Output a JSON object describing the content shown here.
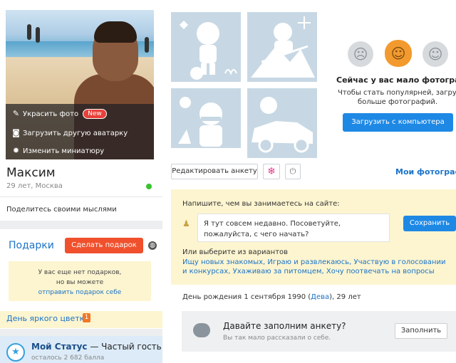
{
  "profile": {
    "name": "Максим",
    "meta": "29 лет, Москва",
    "share_prompt": "Поделитесь своими мыслями",
    "avatar_menu": {
      "decorate": "Украсить фото",
      "decorate_badge": "New",
      "upload_other": "Загрузить другую аватарку",
      "change_thumb": "Изменить миниатюру"
    }
  },
  "gifts": {
    "title": "Подарки",
    "make_gift": "Сделать подарок",
    "empty_text": "У вас еще нет подарков, но вы можете",
    "send_self": "отправить подарок себе",
    "flower_day": "День яркого цветка",
    "flower_count": "1"
  },
  "status": {
    "title": "Мой Статус",
    "level": "Частый гость",
    "sub": "осталось 2 682 балла"
  },
  "photos": {
    "edit_button": "Редактировать анкету",
    "title": "Сейчас у вас мало фотографий",
    "subtitle_1": "Чтобы стать популярней, загрузите",
    "subtitle_2": "больше фотографий.",
    "upload_button": "Загрузить с компьютера",
    "my_photos": "Мои фотографии",
    "faces": [
      "sad",
      "neutral-selected",
      "smile"
    ]
  },
  "about": {
    "label": "Напишите, чем вы занимаетесь на сайте:",
    "input_value": "Я тут совсем недавно. Посоветуйте, пожалуйста, с чего начать?",
    "save_button": "Сохранить",
    "or_label": "Или выберите из вариантов",
    "options": [
      "Ищу новых знакомых,",
      "Играю и развлекаюсь,",
      "Участвую в голосовании и конкурсах,",
      "Ухаживаю за питомцем,",
      "Хочу поотвечать на вопросы"
    ]
  },
  "birthday": {
    "prefix": "День рождения 1 сентября 1990 (",
    "zodiac": "Дева",
    "suffix": "), 29 лет"
  },
  "fill_profile": {
    "title": "Давайте заполним анкету?",
    "sub": "Вы так мало рассказали о себе.",
    "button": "Заполнить"
  },
  "colors": {
    "accent_blue": "#1e88e5",
    "link_blue": "#1a73c8",
    "gift_orange": "#f0502c",
    "yellow_bg": "#fdf5d0",
    "online_green": "#3ac330"
  }
}
